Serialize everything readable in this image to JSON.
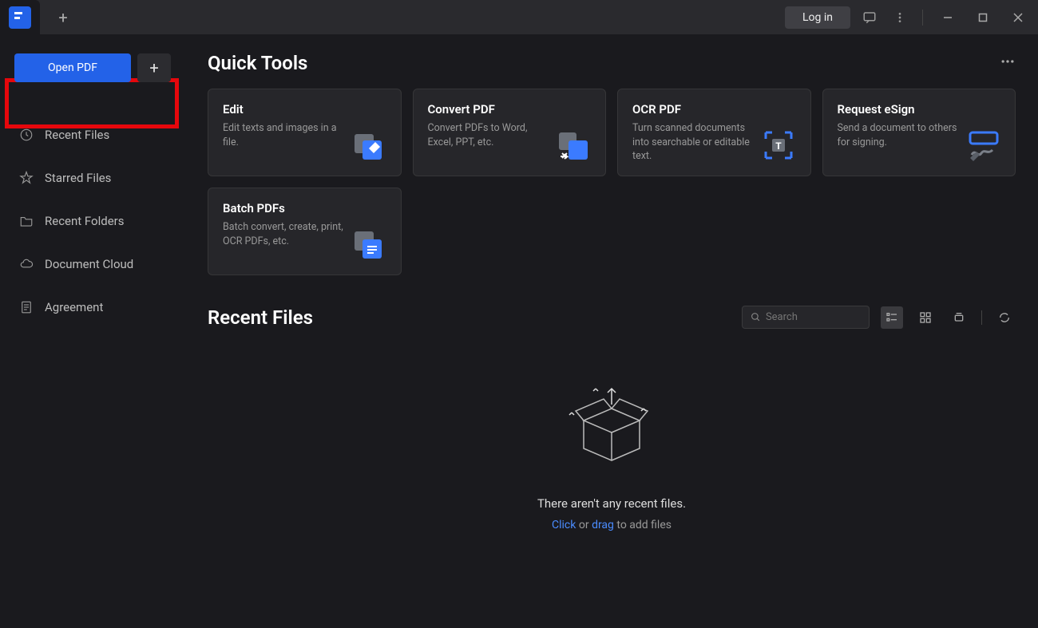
{
  "titlebar": {
    "login_label": "Log in"
  },
  "sidebar": {
    "open_pdf_label": "Open PDF",
    "nav": [
      {
        "label": "Recent Files",
        "icon": "clock"
      },
      {
        "label": "Starred Files",
        "icon": "star"
      },
      {
        "label": "Recent Folders",
        "icon": "folder"
      },
      {
        "label": "Document Cloud",
        "icon": "cloud"
      },
      {
        "label": "Agreement",
        "icon": "document"
      }
    ]
  },
  "quick_tools": {
    "title": "Quick Tools",
    "tools": [
      {
        "title": "Edit",
        "desc": "Edit texts and images in a file."
      },
      {
        "title": "Convert PDF",
        "desc": "Convert PDFs to Word, Excel, PPT, etc."
      },
      {
        "title": "OCR PDF",
        "desc": "Turn scanned documents into searchable or editable text."
      },
      {
        "title": "Request eSign",
        "desc": "Send a document to others for signing."
      },
      {
        "title": "Batch PDFs",
        "desc": "Batch convert, create, print, OCR PDFs, etc."
      }
    ]
  },
  "recent": {
    "title": "Recent Files",
    "search_placeholder": "Search",
    "empty_message": "There aren't any recent files.",
    "empty_action_click": "Click",
    "empty_action_or": " or ",
    "empty_action_drag": "drag",
    "empty_action_rest": " to add files"
  }
}
